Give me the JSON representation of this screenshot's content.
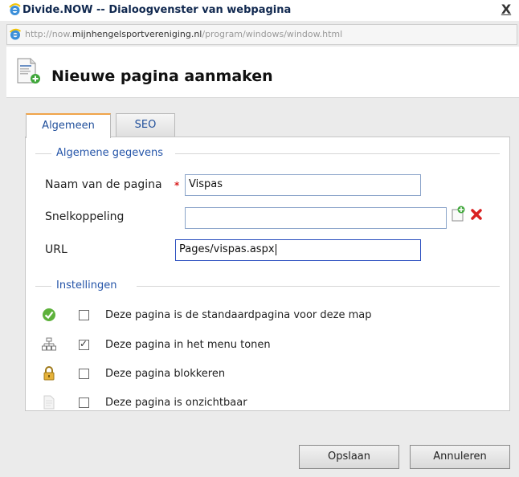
{
  "window": {
    "title": "Divide.NOW -- Dialoogvenster van webpagina",
    "close_label": "X"
  },
  "address": {
    "prefix": "http://now.",
    "domain": "mijnhengelsportvereniging.nl",
    "path": "/program/windows/window.html"
  },
  "header": {
    "title": "Nieuwe pagina aanmaken"
  },
  "tabs": [
    {
      "label": "Algemeen",
      "active": true
    },
    {
      "label": "SEO",
      "active": false
    }
  ],
  "general": {
    "legend": "Algemene gegevens",
    "name_label": "Naam van de pagina",
    "required_mark": "*",
    "name_value": "Vispas",
    "shortcut_label": "Snelkoppeling",
    "shortcut_value": "",
    "url_label": "URL",
    "url_value": "Pages/vispas.aspx"
  },
  "settings": {
    "legend": "Instellingen",
    "items": [
      {
        "icon": "check-circle-icon",
        "checked": false,
        "label": "Deze pagina is de standaardpagina voor deze map"
      },
      {
        "icon": "sitemap-icon",
        "checked": true,
        "label": "Deze pagina in het menu tonen"
      },
      {
        "icon": "lock-icon",
        "checked": false,
        "label": "Deze pagina blokkeren"
      },
      {
        "icon": "hidden-page-icon",
        "checked": false,
        "label": "Deze pagina is onzichtbaar"
      }
    ],
    "check_glyph": "✓"
  },
  "buttons": {
    "save": "Opslaan",
    "cancel": "Annuleren"
  },
  "colors": {
    "tab_accent": "#f0a44a",
    "legend_text": "#2454a8",
    "required": "#d92020",
    "focus_border": "#2b4fbf"
  }
}
